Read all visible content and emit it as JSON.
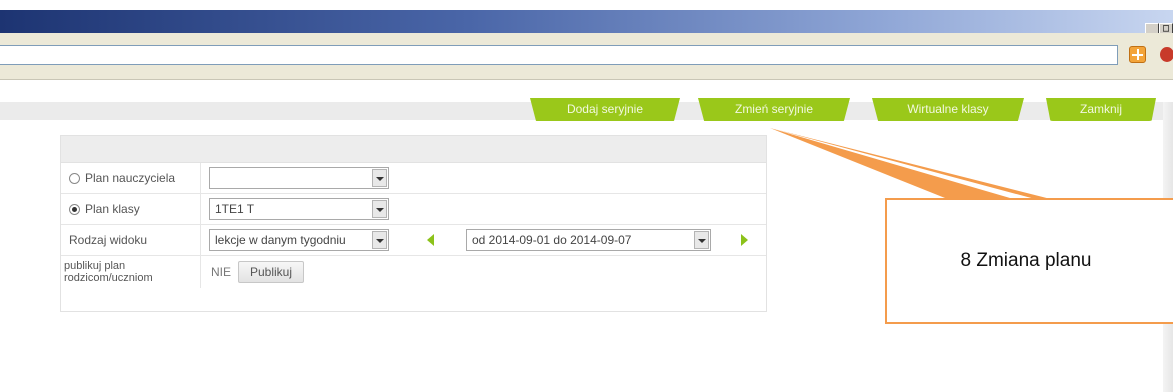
{
  "window": {
    "buttons": [
      "_",
      "□"
    ]
  },
  "toolbar": {
    "address_value": "",
    "icons": [
      "addon-icon",
      "addon-red-icon"
    ]
  },
  "tabs": [
    {
      "label": "Dodaj seryjnie"
    },
    {
      "label": "Zmień seryjnie"
    },
    {
      "label": "Wirtualne klasy"
    },
    {
      "label": "Zamknij"
    }
  ],
  "form": {
    "teacher_label": "Plan nauczyciela",
    "teacher_value": "",
    "class_label": "Plan klasy",
    "class_value": "1TE1 T",
    "view_label": "Rodzaj widoku",
    "view_value": "lekcje w danym tygodniu",
    "date_range": "od 2014-09-01 do 2014-09-07",
    "publish_label": "publikuj plan rodzicom/uczniom",
    "publish_status": "NIE",
    "publish_button": "Publikuj",
    "selected_plan": "class"
  },
  "annotation": {
    "text": "8 Zmiana planu",
    "color": "#f49c4c"
  },
  "colors": {
    "tab_green": "#9ac81a",
    "arrow_green": "#8cc21a",
    "title_dark": "#1d3472"
  }
}
